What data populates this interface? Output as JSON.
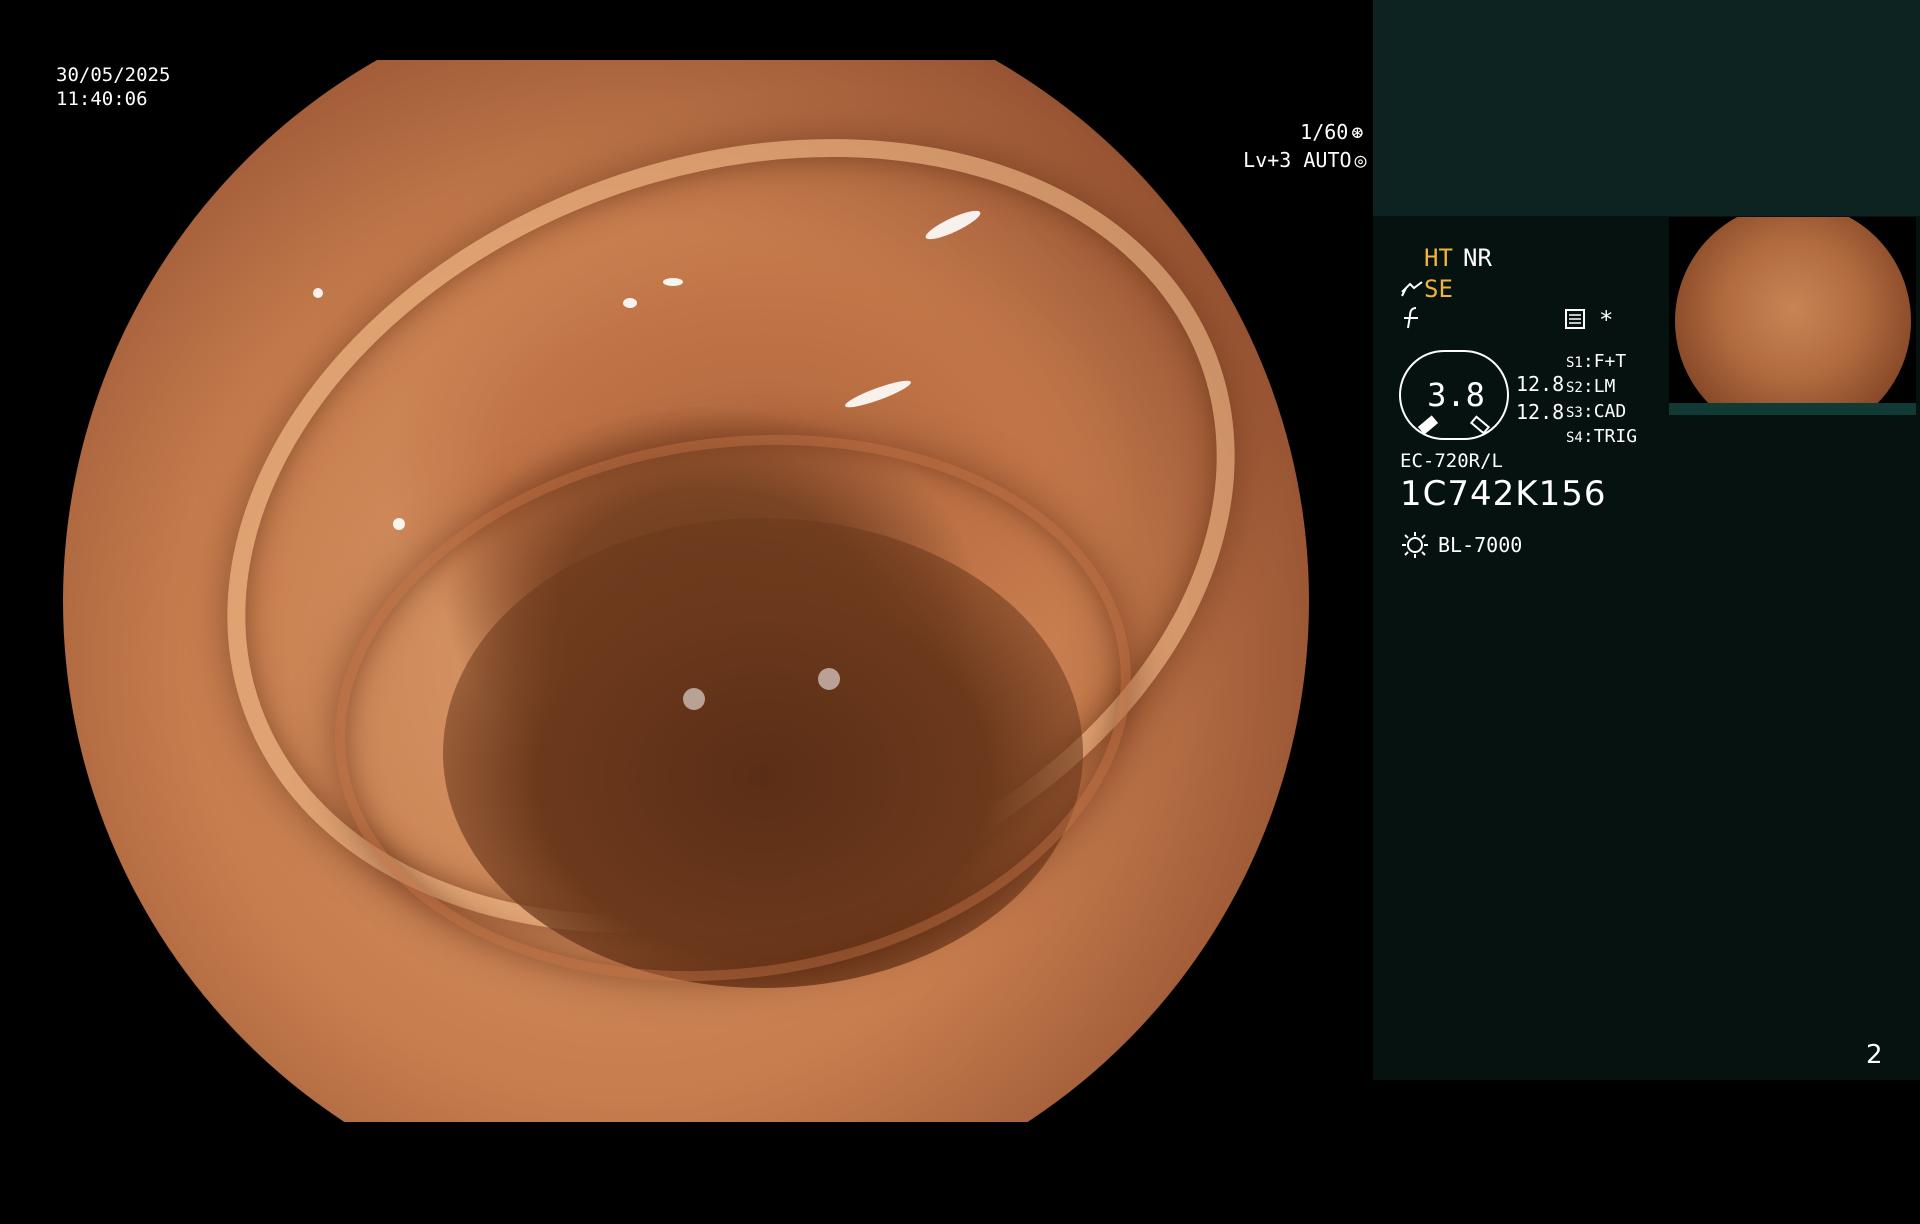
{
  "overlay": {
    "date": "30/05/2025",
    "time": "11:40:06",
    "shutter": "1/60",
    "level": "Lv+3 AUTO"
  },
  "panel": {
    "ht": "HT",
    "nr": "NR",
    "se": "SE",
    "dial_value": "3.8",
    "val1": "12.8",
    "val2": "12.8",
    "s1_label": "S1",
    "s1": "F+T",
    "s2_label": "S2",
    "s2": "LM",
    "s3_label": "S3",
    "s3": "CAD",
    "s4_label": "S4",
    "s4": "TRIG",
    "asterisk": "*",
    "scope_model": "EC-720R/L",
    "serial": "1C742K156",
    "light_source": "BL-7000",
    "page_number": "2"
  },
  "colors": {
    "panel_bg": "#051210",
    "panel_top_bg": "#0c2321",
    "accent_yellow": "#f0b43a"
  }
}
